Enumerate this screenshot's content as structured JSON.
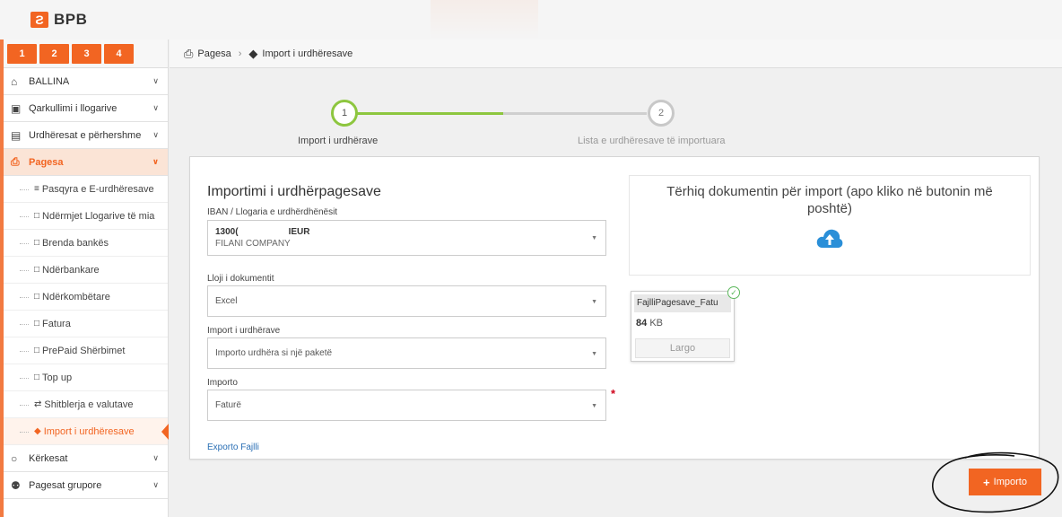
{
  "app": {
    "logo_mark": "Ƨ",
    "logo_text": "BPB"
  },
  "steps_tabs": [
    "1",
    "2",
    "3",
    "4"
  ],
  "breadcrumb": {
    "item1": "Pagesa",
    "item2": "Import i urdhëresave"
  },
  "sidebar": {
    "top_items": [
      {
        "label": "BALLINA",
        "icon": "home-icon"
      },
      {
        "label": "Qarkullimi i llogarive",
        "icon": "money-icon"
      },
      {
        "label": "Urdhëresat e përhershme",
        "icon": "list-icon"
      },
      {
        "label": "Pagesa",
        "icon": "document-icon"
      }
    ],
    "sub_items": [
      {
        "label": "Pasqyra e E-urdhëresave",
        "icon": "list-icon"
      },
      {
        "label": "Ndërmjet Llogarive të mia",
        "icon": "file-icon"
      },
      {
        "label": "Brenda bankës",
        "icon": "file-icon"
      },
      {
        "label": "Ndërbankare",
        "icon": "file-icon"
      },
      {
        "label": "Ndërkombëtare",
        "icon": "file-icon"
      },
      {
        "label": "Fatura",
        "icon": "file-icon"
      },
      {
        "label": "PrePaid Shërbimet",
        "icon": "file-icon"
      },
      {
        "label": "Top up",
        "icon": "file-icon"
      },
      {
        "label": "Shitblerja e valutave",
        "icon": "exchange-icon"
      },
      {
        "label": "Import i urdhëresave",
        "icon": "box-icon"
      }
    ],
    "bottom_items": [
      {
        "label": "Kërkesat",
        "icon": "circle-icon"
      },
      {
        "label": "Pagesat grupore",
        "icon": "group-icon"
      }
    ]
  },
  "wizard": {
    "step1_number": "1",
    "step1_label": "Import i urdhërave",
    "step2_number": "2",
    "step2_label": "Lista e urdhëresave të importuara"
  },
  "form": {
    "title": "Importimi i urdhërpagesave",
    "iban_label": "IBAN / Llogaria e urdhërdhënësit",
    "iban_value_number": "1300(",
    "iban_value_currency": "IEUR",
    "iban_value_name": "FILANI COMPANY",
    "doc_type_label": "Lloji i dokumentit",
    "doc_type_value": "Excel",
    "import_type_label": "Import i urdhërave",
    "import_type_value": "Importo urdhëra si një paketë",
    "importo_label": "Importo",
    "importo_value": "Faturë",
    "required_mark": "*",
    "export_link": "Exporto Fajlli"
  },
  "dropzone": {
    "text": "Tërhiq dokumentin për import (apo kliko në butonin më poshtë)"
  },
  "file": {
    "name": "FajlliPagesave_Fatu",
    "size_value": "84",
    "size_unit": "KB",
    "remove_label": "Largo"
  },
  "actions": {
    "import_label": "Importo"
  },
  "colors": {
    "accent": "#f26522",
    "progress": "#8dc63f",
    "link": "#2a6fb5"
  }
}
